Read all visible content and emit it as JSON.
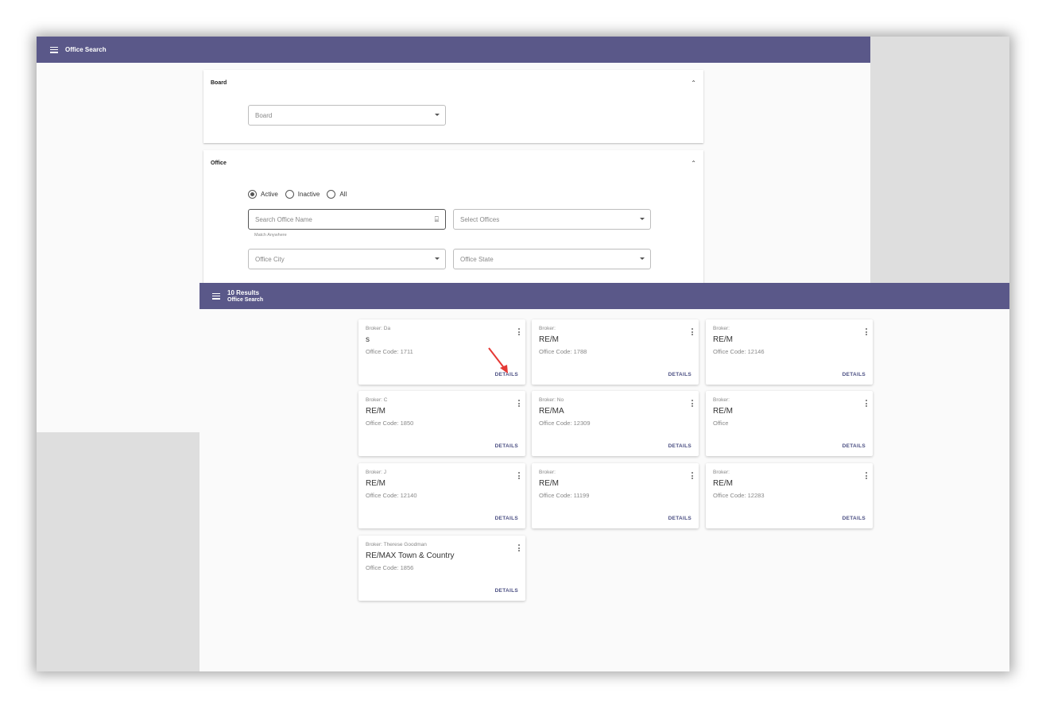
{
  "app": {
    "header_title": "Office Search"
  },
  "board_panel": {
    "title": "Board",
    "collapse_icon": "chevron-up-icon",
    "board_placeholder": "Board"
  },
  "office_panel": {
    "title": "Office",
    "collapse_icon": "chevron-up-icon",
    "status_options": [
      {
        "label": "Active",
        "selected": true
      },
      {
        "label": "Inactive",
        "selected": false
      },
      {
        "label": "All",
        "selected": false
      }
    ],
    "search_placeholder": "Search Office Name",
    "search_hint": "Match Anywhere",
    "offices_placeholder": "Select Offices",
    "city_placeholder": "Office City",
    "state_placeholder": "Office State"
  },
  "results": {
    "count_label": "10 Results",
    "subtitle": "Office Search",
    "details_label": "DETAILS",
    "cards": [
      {
        "broker": "Broker: Da",
        "name": "s",
        "code": "Office Code: 1711"
      },
      {
        "broker": "Broker:",
        "name": "RE/M",
        "code": "Office Code: 1788"
      },
      {
        "broker": "Broker:",
        "name": "RE/M",
        "code": "Office Code: 12146"
      },
      {
        "broker": "Broker: C",
        "name": "RE/M",
        "code": "Office Code: 1850"
      },
      {
        "broker": "Broker: No",
        "name": "RE/MA",
        "code": "Office Code: 12309"
      },
      {
        "broker": "Broker:",
        "name": "RE/M",
        "code": "Office"
      },
      {
        "broker": "Broker: J",
        "name": "RE/M",
        "code": "Office Code: 12140"
      },
      {
        "broker": "Broker:",
        "name": "RE/M",
        "code": "Office Code: 11199"
      },
      {
        "broker": "Broker:",
        "name": "RE/M",
        "code": "Office Code: 12283"
      },
      {
        "broker": "Broker: Therese Goodman",
        "name": "RE/MAX Town & Country",
        "code": "Office Code: 1856"
      }
    ]
  },
  "colors": {
    "header_bar": "#5a5889",
    "details_text": "#4b4f83",
    "annotation_arrow": "#e53935"
  }
}
